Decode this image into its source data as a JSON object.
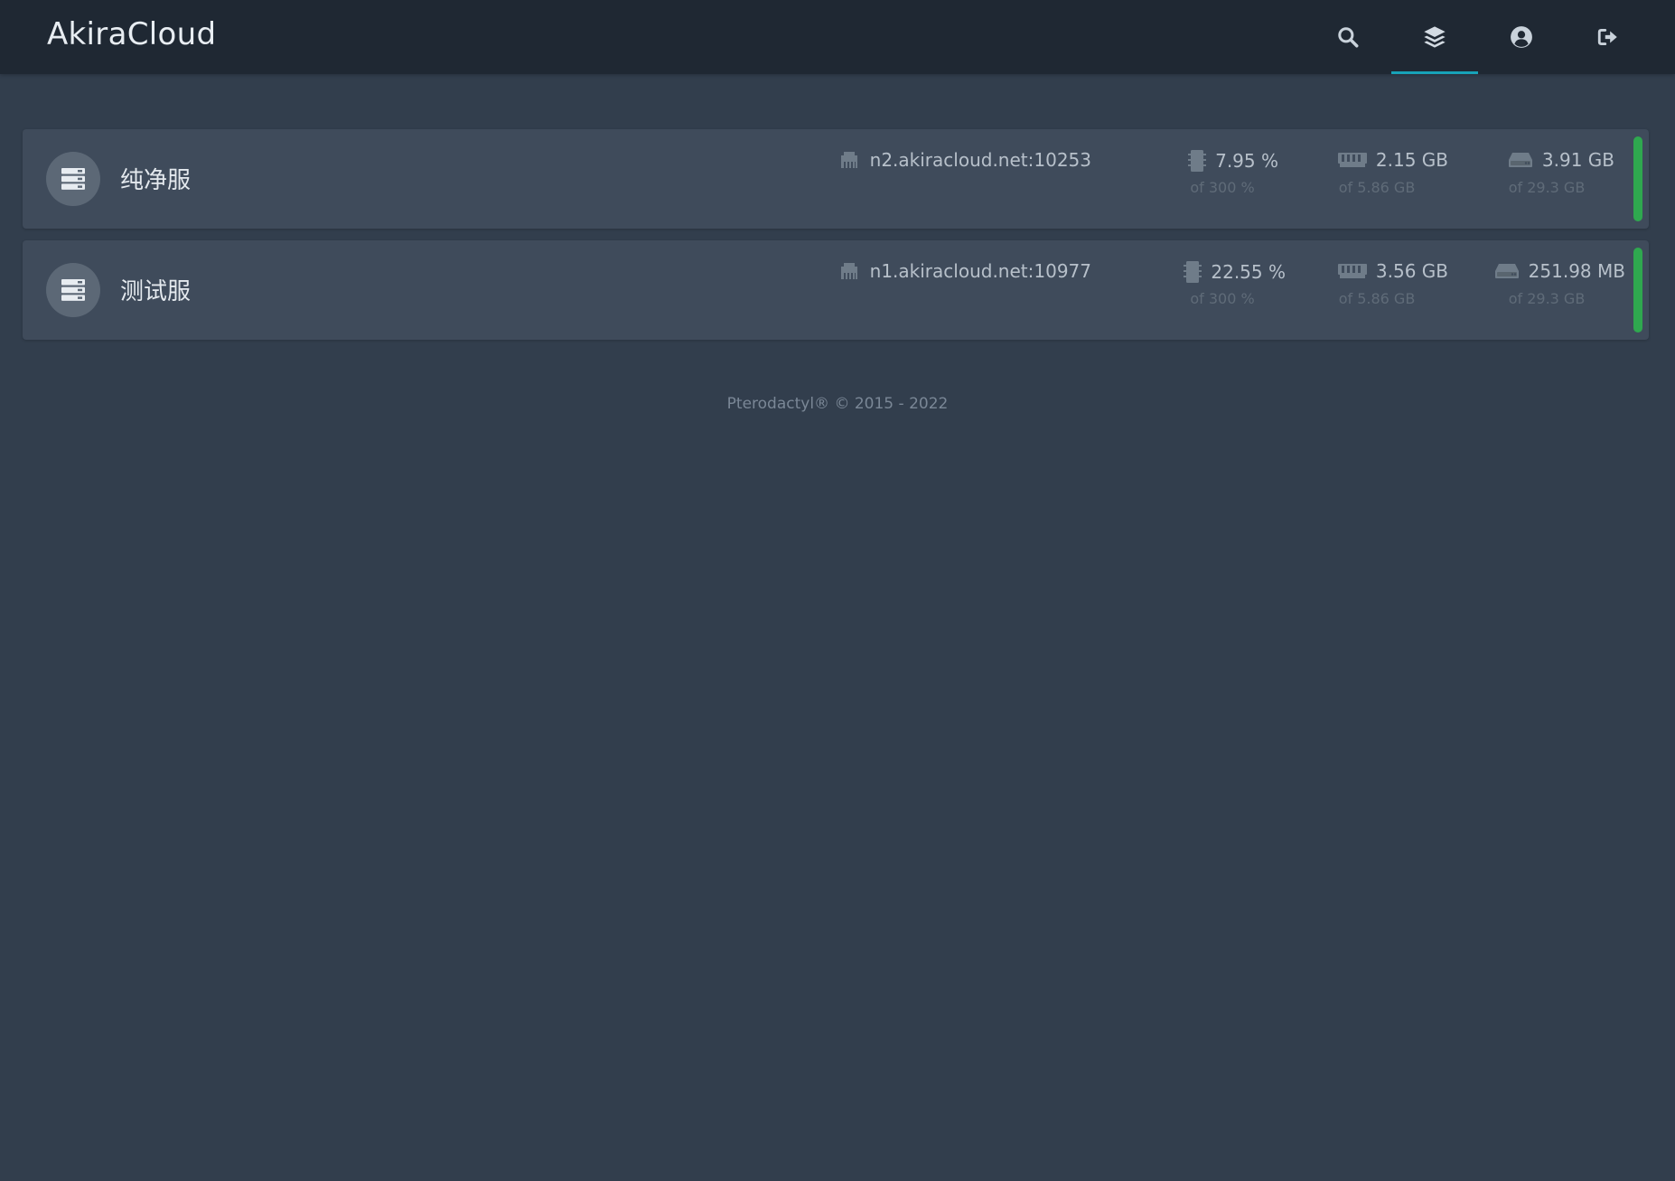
{
  "app": {
    "brand": "AkiraCloud"
  },
  "nav": {
    "items": [
      {
        "icon": "search-icon"
      },
      {
        "icon": "layer-group-icon",
        "active": true
      },
      {
        "icon": "user-circle-icon"
      },
      {
        "icon": "sign-out-icon"
      }
    ]
  },
  "servers": [
    {
      "name": "纯净服",
      "address": "n2.akiracloud.net:10253",
      "cpu": {
        "value": "7.95 %",
        "limit": "of 300 %"
      },
      "memory": {
        "value": "2.15 GB",
        "limit": "of 5.86 GB"
      },
      "disk": {
        "value": "3.91 GB",
        "limit": "of 29.3 GB"
      },
      "status_color": "#2fa84f"
    },
    {
      "name": "测试服",
      "address": "n1.akiracloud.net:10977",
      "cpu": {
        "value": "22.55 %",
        "limit": "of 300 %"
      },
      "memory": {
        "value": "3.56 GB",
        "limit": "of 5.86 GB"
      },
      "disk": {
        "value": "251.98 MB",
        "limit": "of 29.3 GB"
      },
      "status_color": "#2fa84f"
    }
  ],
  "footer": {
    "text": "Pterodactyl® © 2015 - 2022"
  },
  "colors": {
    "background": "#323e4d",
    "topbar": "#1f2833",
    "card": "#3f4b5b",
    "accent": "#17a2b8",
    "status_online": "#2fa84f"
  }
}
